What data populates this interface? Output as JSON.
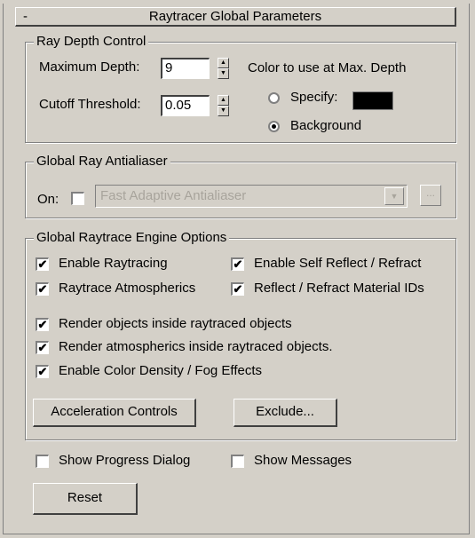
{
  "panel": {
    "title": "Raytracer Global Parameters",
    "collapse_symbol": "-"
  },
  "ray_depth": {
    "group_title": "Ray Depth Control",
    "max_depth_label": "Maximum Depth:",
    "max_depth_value": "9",
    "cutoff_label": "Cutoff Threshold:",
    "cutoff_value": "0.05",
    "color_label": "Color to use at Max. Depth",
    "specify_label": "Specify:",
    "background_label": "Background",
    "specify_selected": false,
    "background_selected": true,
    "swatch_color": "#000000"
  },
  "antialiaser": {
    "group_title": "Global Ray Antialiaser",
    "on_label": "On:",
    "on_checked": false,
    "selected_option": "Fast Adaptive Antialiaser",
    "more_button": "..."
  },
  "engine": {
    "group_title": "Global Raytrace Engine Options",
    "enable_raytracing": "Enable Raytracing",
    "enable_self_reflect": "Enable Self Reflect / Refract",
    "raytrace_atmospherics": "Raytrace Atmospherics",
    "reflect_refract_ids": "Reflect / Refract Material IDs",
    "render_objects_inside": "Render objects inside raytraced objects",
    "render_atmospherics_inside": "Render atmospherics inside raytraced objects.",
    "enable_color_density": "Enable Color Density / Fog Effects",
    "acceleration_button": "Acceleration Controls",
    "exclude_button": "Exclude...",
    "check_mark": "✔"
  },
  "footer": {
    "show_progress": "Show Progress Dialog",
    "show_messages": "Show Messages",
    "reset_button": "Reset"
  },
  "icons": {
    "spinner_up": "▲",
    "spinner_down": "▼",
    "dropdown_arrow": "▼"
  }
}
